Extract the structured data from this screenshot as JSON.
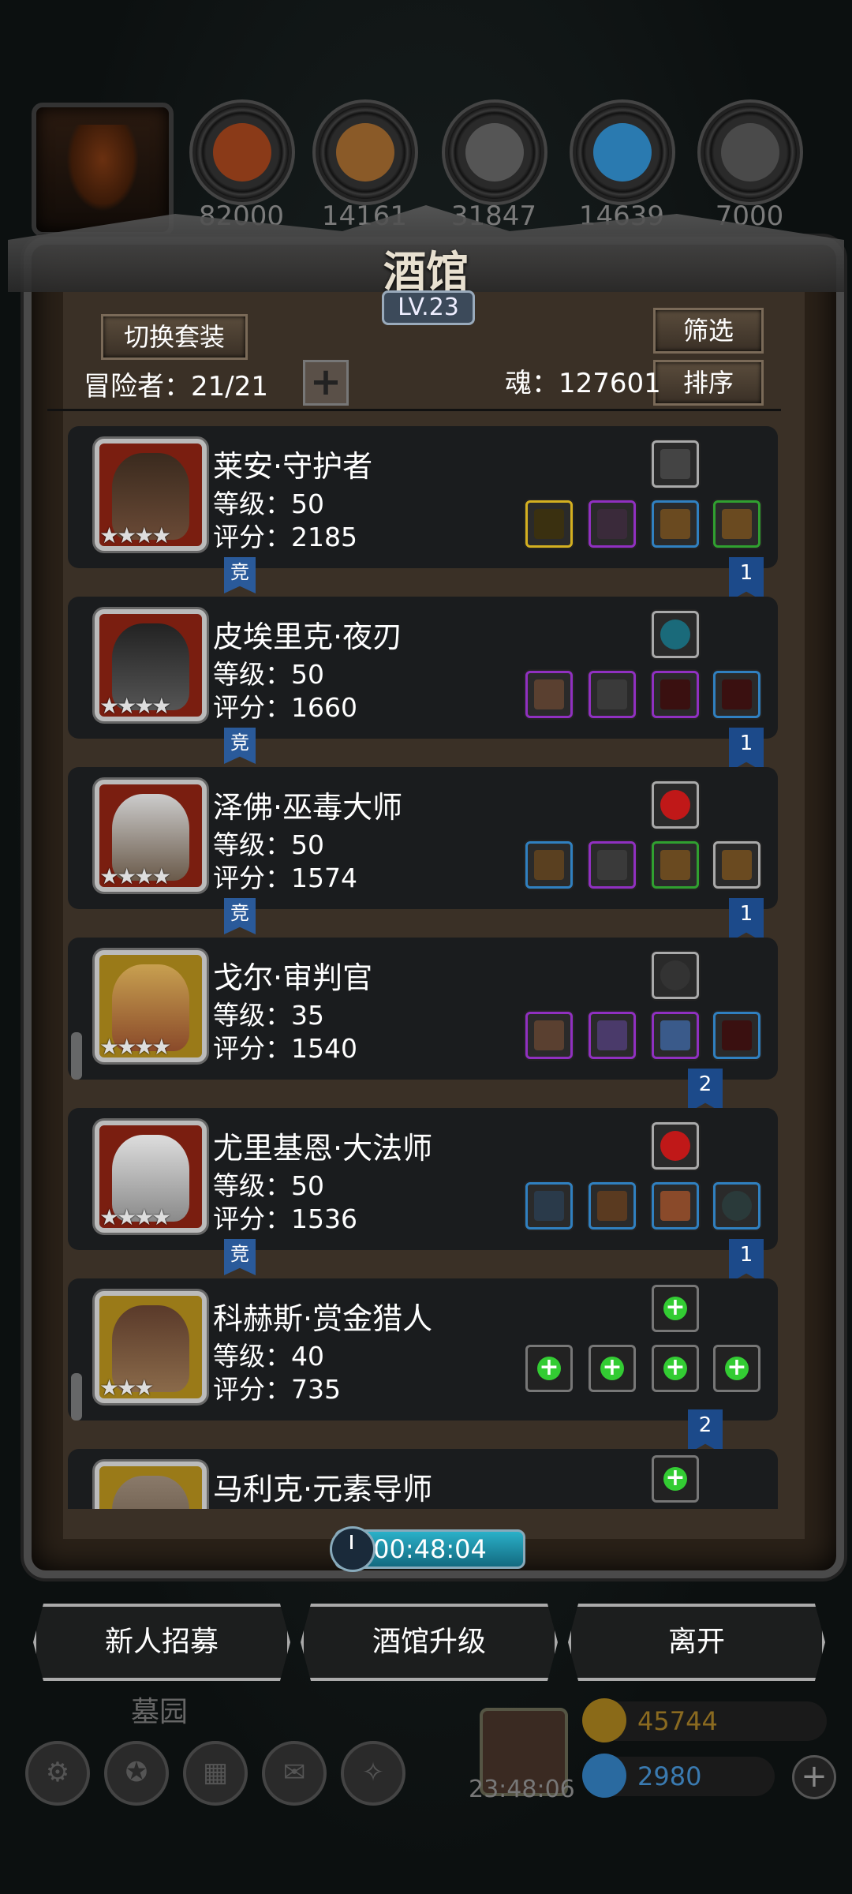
{
  "resources": [
    {
      "name": "leather",
      "count": "82000",
      "color": "#8a3a18"
    },
    {
      "name": "wood",
      "count": "14161",
      "color": "#8a5a28"
    },
    {
      "name": "stone",
      "count": "31847",
      "color": "#555555"
    },
    {
      "name": "crystal",
      "count": "14639",
      "color": "#2a7ab0"
    },
    {
      "name": "iron",
      "count": "7000",
      "color": "#4a4a4a"
    }
  ],
  "title": "酒馆",
  "level": "LV.23",
  "buttons": {
    "switch_set": "切换套装",
    "filter": "筛选",
    "sort": "排序"
  },
  "adventurers_label": "冒险者：21/21",
  "soul_label": "魂：127601",
  "heroes": [
    {
      "name": "莱安·守护者",
      "level": "等级：50",
      "score": "评分：2185",
      "stars": "★★★★",
      "frame": "red",
      "jing": "竞",
      "rank": "1"
    },
    {
      "name": "皮埃里克·夜刃",
      "level": "等级：50",
      "score": "评分：1660",
      "stars": "★★★★",
      "frame": "red",
      "jing": "竞",
      "rank": "1"
    },
    {
      "name": "泽佛·巫毒大师",
      "level": "等级：50",
      "score": "评分：1574",
      "stars": "★★★★",
      "frame": "red",
      "jing": "竞",
      "rank": "1"
    },
    {
      "name": "戈尔·审判官",
      "level": "等级：35",
      "score": "评分：1540",
      "stars": "★★★★",
      "frame": "gold",
      "jing": "",
      "rank": "2"
    },
    {
      "name": "尤里基恩·大法师",
      "level": "等级：50",
      "score": "评分：1536",
      "stars": "★★★★",
      "frame": "red",
      "jing": "竞",
      "rank": "1"
    },
    {
      "name": "科赫斯·赏金猎人",
      "level": "等级：40",
      "score": "评分：735",
      "stars": "★★★",
      "frame": "gold",
      "jing": "",
      "rank": "2"
    },
    {
      "name": "马利克·元素导师",
      "level": "",
      "score": "",
      "stars": "",
      "frame": "gold",
      "jing": "",
      "rank": ""
    }
  ],
  "timer": "00:48:04",
  "bottom_buttons": {
    "recruit": "新人招募",
    "upgrade": "酒馆升级",
    "leave": "离开"
  },
  "footer": {
    "label": "墓园",
    "gift_timer": "23:48:06",
    "gold": "45744",
    "gems": "2980",
    "add": "+"
  },
  "colors": {
    "panel": "#3a3026",
    "card": "#1a1c1e",
    "accent_blue": "#1c4a8a",
    "timer": "#2ab0c8"
  }
}
